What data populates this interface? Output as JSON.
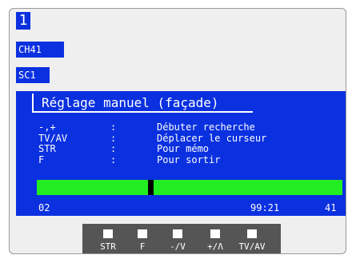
{
  "osd": {
    "program_number": "1",
    "channel": "CH41",
    "source": "SC1"
  },
  "panel": {
    "title": "Réglage manuel (façade)",
    "help_rows": [
      {
        "key": "-,+",
        "sep": ":",
        "desc": "Débuter recherche"
      },
      {
        "key": "TV/AV",
        "sep": ":",
        "desc": "Déplacer le curseur"
      },
      {
        "key": "STR",
        "sep": ":",
        "desc": "Pour mémo"
      },
      {
        "key": "F",
        "sep": ":",
        "desc": "Pour sortir"
      }
    ],
    "tuning_position": 0.37,
    "status_left": "02",
    "status_time": "99:21",
    "status_right": "41"
  },
  "buttons": [
    {
      "label": "STR"
    },
    {
      "label": "F"
    },
    {
      "label": "-/V"
    },
    {
      "label": "+/Λ"
    },
    {
      "label": "TV/AV"
    }
  ],
  "colors": {
    "osd_blue": "#0a30e0",
    "tuning_bar": "#22ec22",
    "button_panel": "#555555"
  }
}
